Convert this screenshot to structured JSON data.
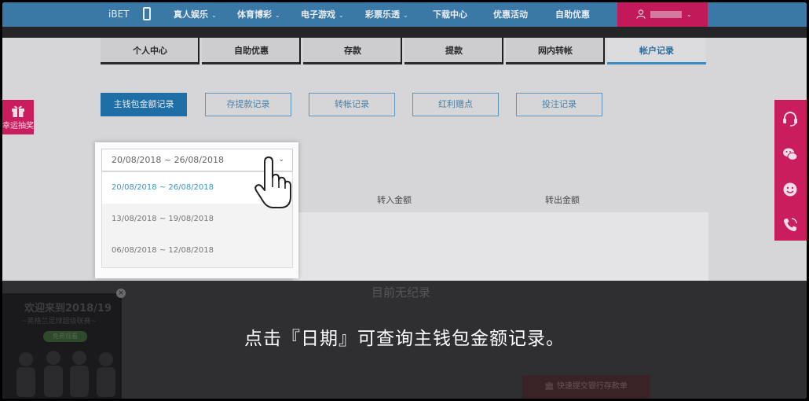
{
  "nav": {
    "brand": "iBET",
    "items": [
      "真人娱乐",
      "体育博彩",
      "电子游戏",
      "彩票乐透",
      "下载中心",
      "优惠活动",
      "自助优惠"
    ],
    "caret": "⌄"
  },
  "tabs": [
    "个人中心",
    "自助优惠",
    "存款",
    "提款",
    "网内转帐",
    "帐户记录"
  ],
  "active_tab": "帐户记录",
  "sub_buttons": [
    "主钱包金额记录",
    "存提款记录",
    "转帐记录",
    "红利赠点",
    "投注记录"
  ],
  "side": {
    "gift_label": "幸运抽奖"
  },
  "date_select": {
    "selected": "20/08/2018 ~ 26/08/2018",
    "options": [
      "20/08/2018 ~ 26/08/2018",
      "13/08/2018 ~ 19/08/2018",
      "06/08/2018 ~ 12/08/2018"
    ]
  },
  "table": {
    "headers": [
      "转入金额",
      "转出金额"
    ],
    "empty": "目前无纪录"
  },
  "caption": "点击『日期』可查询主钱包金额记录。",
  "promo": {
    "title": "欢迎来到2018/19",
    "subtitle": "~英格兰足球超级联赛~",
    "button": "免费观看",
    "close": "×"
  },
  "deposit_button": "快速提交银行存款单",
  "colors": {
    "nav": "#3a78a6",
    "accent": "#c91d5d",
    "active_tab": "#3a8dc4"
  }
}
